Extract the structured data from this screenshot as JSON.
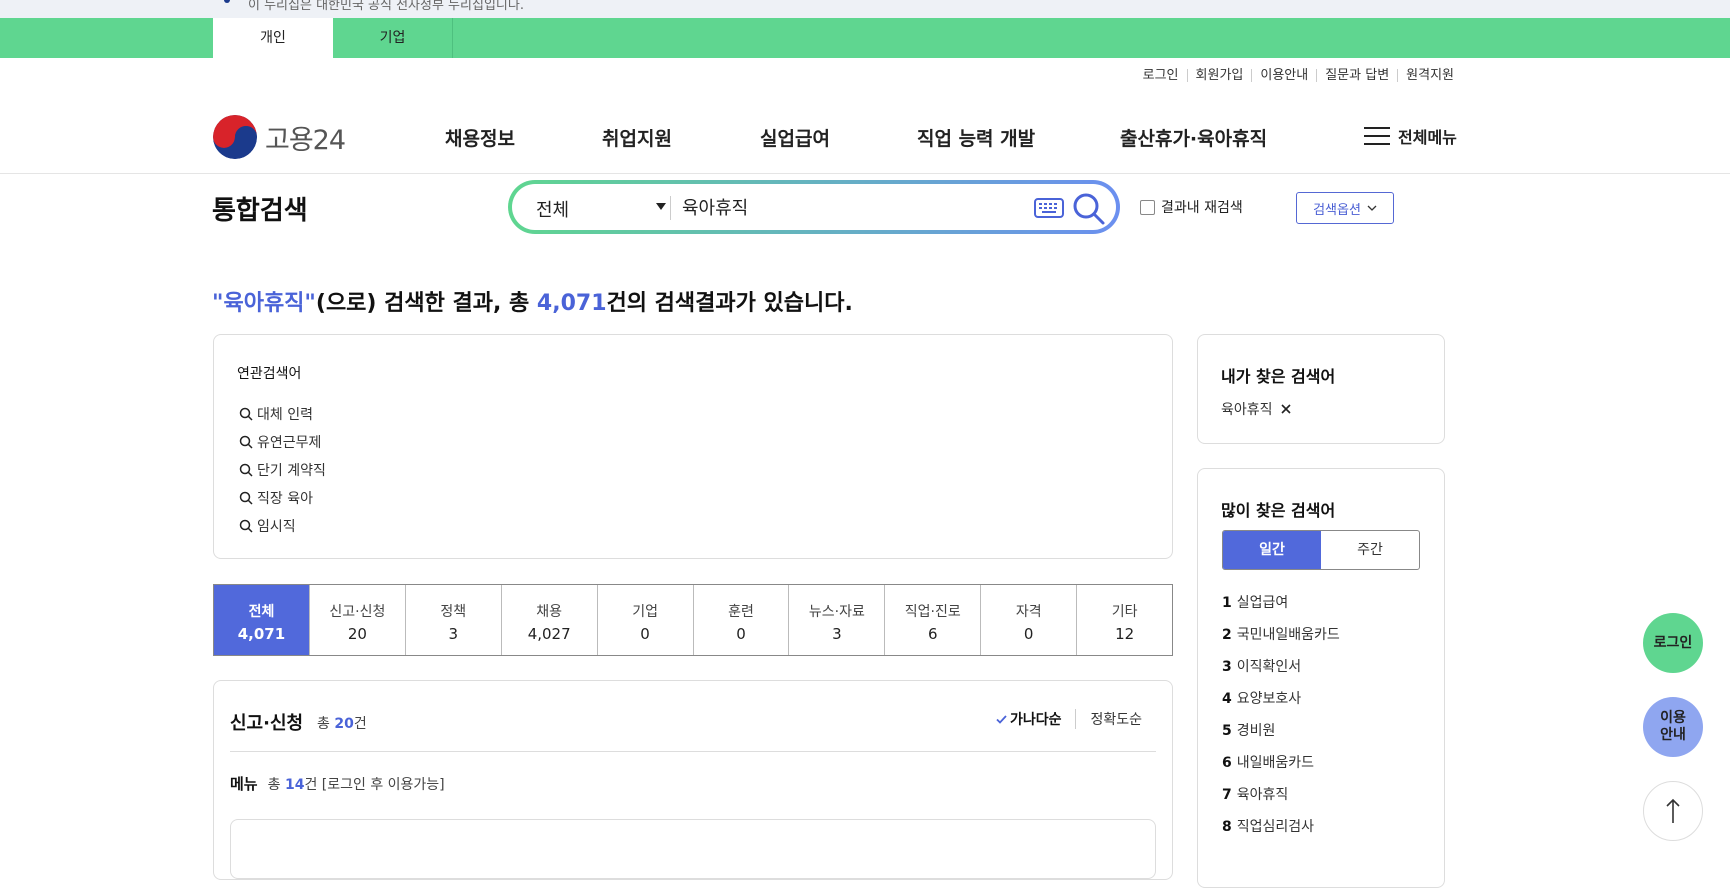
{
  "gov_banner": {
    "text": "이 누리집은 대한민국 공식 전자정부 누리집입니다."
  },
  "top_tabs": [
    "개인",
    "기업"
  ],
  "util_links": [
    "로그인",
    "회원가입",
    "이용안내",
    "질문과 답변",
    "원격지원"
  ],
  "logo_text": "고용24",
  "gnb": [
    "채용정보",
    "취업지원",
    "실업급여",
    "직업 능력 개발",
    "출산휴가·육아휴직"
  ],
  "all_menu": "전체메뉴",
  "search": {
    "title": "통합검색",
    "category": "전체",
    "query": "육아휴직",
    "recheck_label": "결과내 재검색",
    "options_label": "검색옵션"
  },
  "result_summary": {
    "quote_keyword": "\"육아휴직\"",
    "mid": "(으로) 검색한 결과, 총 ",
    "total": "4,071",
    "tail": "건의 검색결과가 있습니다."
  },
  "related": {
    "title": "연관검색어",
    "items": [
      "대체 인력",
      "유연근무제",
      "단기 계약직",
      "직장 육아",
      "임시직"
    ]
  },
  "categories": [
    {
      "label": "전체",
      "count": "4,071"
    },
    {
      "label": "신고·신청",
      "count": "20"
    },
    {
      "label": "정책",
      "count": "3"
    },
    {
      "label": "채용",
      "count": "4,027"
    },
    {
      "label": "기업",
      "count": "0"
    },
    {
      "label": "훈련",
      "count": "0"
    },
    {
      "label": "뉴스·자료",
      "count": "3"
    },
    {
      "label": "직업·진로",
      "count": "6"
    },
    {
      "label": "자격",
      "count": "0"
    },
    {
      "label": "기타",
      "count": "12"
    }
  ],
  "result_panel": {
    "title": "신고·신청",
    "count_prefix": "총 ",
    "count": "20",
    "count_suffix": "건",
    "sort_options": [
      "가나다순",
      "정확도순"
    ],
    "menu_label": "메뉴",
    "menu_count_prefix": "총 ",
    "menu_count": "14",
    "menu_count_suffix": "건 [로그인 후 이용가능]"
  },
  "my_keywords": {
    "title": "내가 찾은 검색어",
    "items": [
      "육아휴직"
    ]
  },
  "popular": {
    "title": "많이 찾은 검색어",
    "periods": [
      "일간",
      "주간"
    ],
    "items": [
      {
        "rank": "1",
        "text": "실업급여"
      },
      {
        "rank": "2",
        "text": "국민내일배움카드"
      },
      {
        "rank": "3",
        "text": "이직확인서"
      },
      {
        "rank": "4",
        "text": "요양보호사"
      },
      {
        "rank": "5",
        "text": "경비원"
      },
      {
        "rank": "6",
        "text": "내일배움카드"
      },
      {
        "rank": "7",
        "text": "육아휴직"
      },
      {
        "rank": "8",
        "text": "직업심리검사"
      }
    ]
  },
  "floating": {
    "login": "로그인",
    "guide_1": "이용",
    "guide_2": "안내"
  },
  "colors": {
    "accent_green": "#5fd690",
    "accent_blue": "#5169db"
  }
}
